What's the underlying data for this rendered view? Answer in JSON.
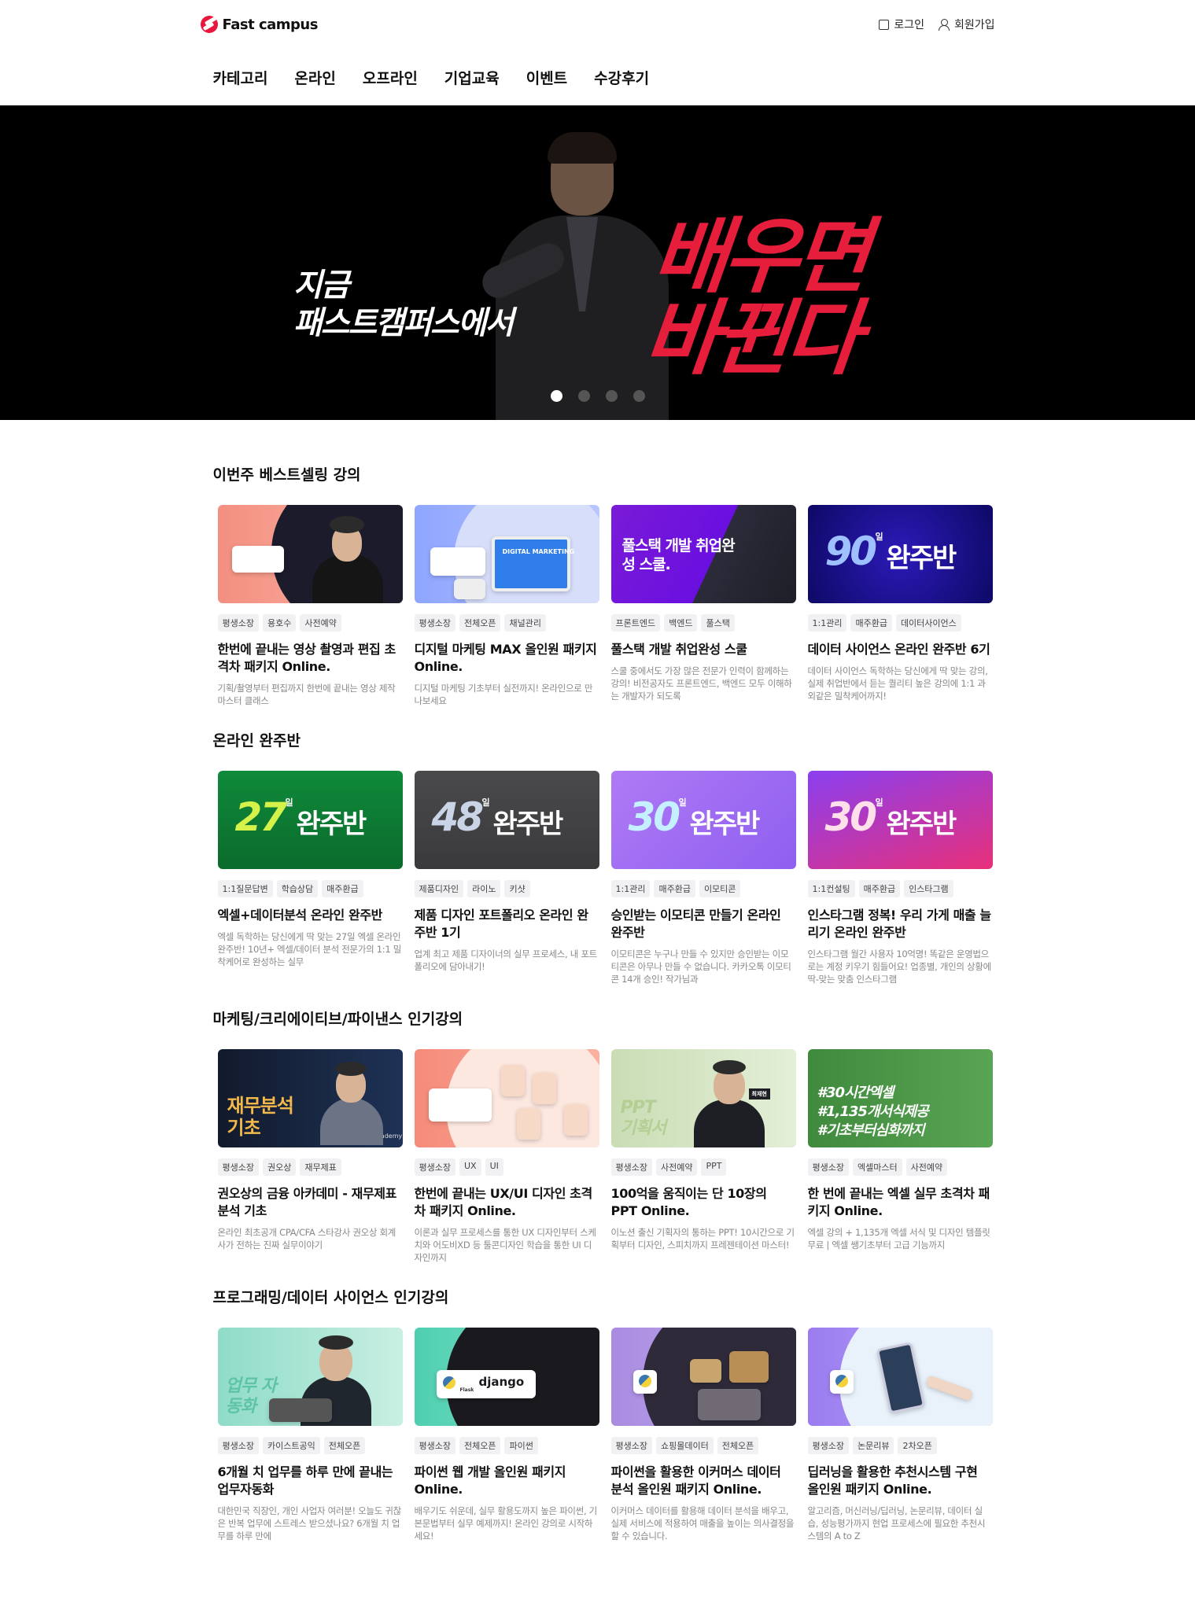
{
  "header": {
    "logo_text": "Fast campus",
    "login": "로그인",
    "signup": "회원가입"
  },
  "nav": [
    "카테고리",
    "온라인",
    "오프라인",
    "기업교육",
    "이벤트",
    "수강후기"
  ],
  "hero": {
    "left_line1": "지금",
    "left_line2": "패스트캠퍼스에서",
    "right_line1": "배우면",
    "right_line2": "바뀐다",
    "slides": 4,
    "active_slide": 1
  },
  "sections": [
    {
      "title": "이번주 베스트셀링 강의",
      "cards": [
        {
          "tags": [
            "평생소장",
            "용호수",
            "사전예약"
          ],
          "title": "한번에 끝내는 영상 촬영과 편집 초격차 패키지 Online.",
          "desc": "기획/촬영부터 편집까지 한번에 끝내는 영상 제작 마스터 클래스"
        },
        {
          "tags": [
            "평생소장",
            "전체오픈",
            "채널관리"
          ],
          "title": "디지털 마케팅 MAX 올인원 패키지 Online.",
          "desc": "디지털 마케팅 기초부터 실전까지! 온라인으로 만나보세요",
          "thumb_text": "DIGITAL MARKETING"
        },
        {
          "tags": [
            "프론트엔드",
            "백엔드",
            "풀스택"
          ],
          "title": "풀스택 개발 취업완성 스쿨",
          "desc": "스쿨 중에서도 가장 많은 전문가 인력이 함께하는 강의! 비전공자도 프론트엔드, 백엔드 모두 이해하는 개발자가 되도록",
          "thumb_text": "풀스택 개발 취업완성 스쿨."
        },
        {
          "tags": [
            "1:1관리",
            "매주환급",
            "데이터사이언스"
          ],
          "title": "데이터 사이언스 온라인 완주반 6기",
          "desc": "데이터 사이언스 독학하는 당신에게 딱 맞는 강의, 실제 취업반에서 듣는 퀄리티 높은 강의에 1:1 과외같은 밀착케어까지!",
          "thumb_num": "90",
          "thumb_day": "일",
          "thumb_text": "완주반"
        }
      ]
    },
    {
      "title": "온라인 완주반",
      "cards": [
        {
          "tags": [
            "1:1질문답변",
            "학습상담",
            "매주환급"
          ],
          "title": "엑셀+데이터분석 온라인 완주반",
          "desc": "엑셀 독학하는 당신에게 딱 맞는 27일 엑셀 온라인 완주반! 10년+ 엑셀/데이터 분석 전문가의 1:1 밀착케어로 완성하는 실무",
          "thumb_num": "27",
          "thumb_day": "일",
          "thumb_text": "완주반"
        },
        {
          "tags": [
            "제품디자인",
            "라이노",
            "키샷"
          ],
          "title": "제품 디자인 포트폴리오 온라인 완주반 1기",
          "desc": "업계 최고 제품 디자이너의 실무 프로세스, 내 포트폴리오에 담아내기!",
          "thumb_num": "48",
          "thumb_day": "일",
          "thumb_text": "완주반"
        },
        {
          "tags": [
            "1:1관리",
            "매주환급",
            "이모티콘"
          ],
          "title": "승인받는 이모티콘 만들기 온라인 완주반",
          "desc": "이모티콘은 누구나 만들 수 있지만 승인받는 이모티콘은 아무나 만들 수 없습니다. 카카오톡 이모티콘 14개 승인! 작가님과",
          "thumb_num": "30",
          "thumb_day": "일",
          "thumb_text": "완주반"
        },
        {
          "tags": [
            "1:1컨설팅",
            "매주환급",
            "인스타그램"
          ],
          "title": "인스타그램 정복! 우리 가게 매출 늘리기 온라인 완주반",
          "desc": "인스타그램 월간 사용자 10억명! 똑같은 운영법으로는 계정 키우기 힘들어요! 업종별, 개인의 상황에 딱-맞는 맞춤 인스타그램",
          "thumb_num": "30",
          "thumb_day": "일",
          "thumb_text": "완주반"
        }
      ]
    },
    {
      "title": "마케팅/크리에이티브/파이낸스 인기강의",
      "cards": [
        {
          "tags": [
            "평생소장",
            "권오상",
            "재무제표"
          ],
          "title": "권오상의 금융 아카데미 - 재무제표 분석 기초",
          "desc": "온라인 최초공개 CPA/CFA 스타강사 권오상 회계사가 전하는 진짜 실무이야기",
          "thumb_text": "재무분석 기초",
          "thumb_sub": "Financial Academy"
        },
        {
          "tags": [
            "평생소장",
            "UX",
            "UI"
          ],
          "title": "한번에 끝내는 UX/UI 디자인 초격차 패키지 Online.",
          "desc": "이론과 실무 프로세스를 통한 UX 디자인부터 스케치와 어도비XD 등 툴콘디자인 학습을 통한 UI 디자인까지"
        },
        {
          "tags": [
            "평생소장",
            "사전예약",
            "PPT"
          ],
          "title": "100억을 움직이는 단 10장의 PPT Online.",
          "desc": "이노션 출신 기획자의 통하는 PPT! 10시간으로 기획부터 디자인, 스피치까지 프레젠테이션 마스터!",
          "thumb_text": "PPT 기획서",
          "thumb_badge": "최재현"
        },
        {
          "tags": [
            "평생소장",
            "엑셀마스터",
            "사전예약"
          ],
          "title": "한 번에 끝내는 엑셀 실무 초격차 패키지 Online.",
          "desc": "엑셀 강의 + 1,135개 엑셀 서식 및 디자인 템플릿 무료 | 엑셀 쌩기초부터 고급 기능까지",
          "thumb_lines": [
            "#30시간엑셀",
            "#1,135개서식제공",
            "#기초부터심화까지"
          ]
        }
      ]
    },
    {
      "title": "프로그래밍/데이터 사이언스 인기강의",
      "cards": [
        {
          "tags": [
            "평생소장",
            "카이스트공익",
            "전체오픈"
          ],
          "title": "6개월 치 업무를 하루 만에 끝내는 업무자동화",
          "desc": "대한민국 직장인, 개인 사업자 여러분! 오늘도 귀찮은 반복 업무에 스트레스 받으셨나요? 6개월 치 업무를 하루 만에",
          "thumb_text": "업무 자동화"
        },
        {
          "tags": [
            "평생소장",
            "전체오픈",
            "파이썬"
          ],
          "title": "파이썬 웹 개발 올인원 패키지 Online.",
          "desc": "배우기도 쉬운데, 실무 활용도까지 높은 파이썬, 기본문법부터 실무 예제까지! 온라인 강의로 시작하세요!",
          "thumb_text": "django",
          "thumb_sub": "Flask"
        },
        {
          "tags": [
            "평생소장",
            "쇼핑몰데이터",
            "전체오픈"
          ],
          "title": "파이썬을 활용한 이커머스 데이터 분석 올인원 패키지 Online.",
          "desc": "이커머스 데이터를 활용해 데이터 분석을 배우고, 실제 서비스에 적용하여 매출을 높이는 의사결정을 할 수 있습니다."
        },
        {
          "tags": [
            "평생소장",
            "논문리뷰",
            "2차오픈"
          ],
          "title": "딥러닝을 활용한 추천시스템 구현 올인원 패키지 Online.",
          "desc": "알고리즘, 머신러닝/딥러닝, 논문리뷰, 데이터 실습, 성능평가까지 현업 프로세스에 필요한 추천시스템의 A to Z"
        }
      ]
    }
  ]
}
